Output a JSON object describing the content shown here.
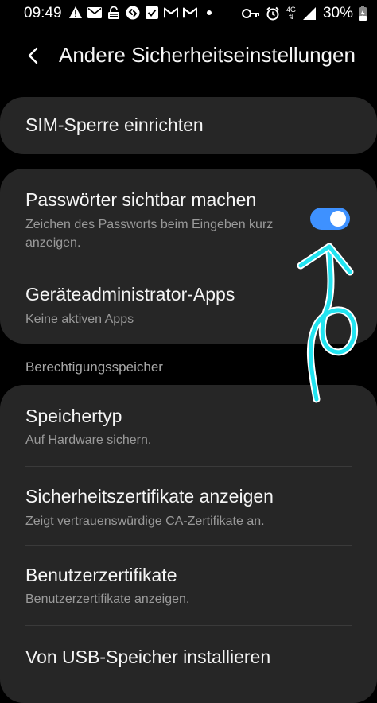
{
  "status_bar": {
    "time": "09:49",
    "battery": "30%",
    "network": "4G",
    "left_icons": [
      "warning-icon",
      "mail-icon",
      "lock-screen-icon",
      "shazam-icon",
      "check-icon",
      "gmail-icon",
      "gmail-icon",
      "dot-icon"
    ],
    "right_icons": [
      "key-icon",
      "alarm-icon",
      "signal-icon",
      "battery-charging-icon"
    ]
  },
  "app_bar": {
    "title": "Andere Sicherheitseinstellungen"
  },
  "sim_lock": {
    "title": "SIM-Sperre einrichten"
  },
  "show_passwords": {
    "title": "Passwörter sichtbar machen",
    "subtitle": "Zeichen des Passworts beim Eingeben kurz anzeigen.",
    "enabled": true
  },
  "device_admin": {
    "title": "Geräteadministrator-Apps",
    "subtitle": "Keine aktiven Apps"
  },
  "credential_section": {
    "header": "Berechtigungsspeicher",
    "items": [
      {
        "title": "Speichertyp",
        "subtitle": "Auf Hardware sichern."
      },
      {
        "title": "Sicherheitszertifikate anzeigen",
        "subtitle": "Zeigt vertrauenswürdige CA-Zertifikate an."
      },
      {
        "title": "Benutzerzertifikate",
        "subtitle": "Benutzerzertifikate anzeigen."
      },
      {
        "title": "Von USB-Speicher installieren",
        "subtitle": ""
      }
    ]
  },
  "colors": {
    "background": "#000000",
    "card": "#262626",
    "accent": "#3e91ff",
    "annotation": "#22e3f0"
  }
}
